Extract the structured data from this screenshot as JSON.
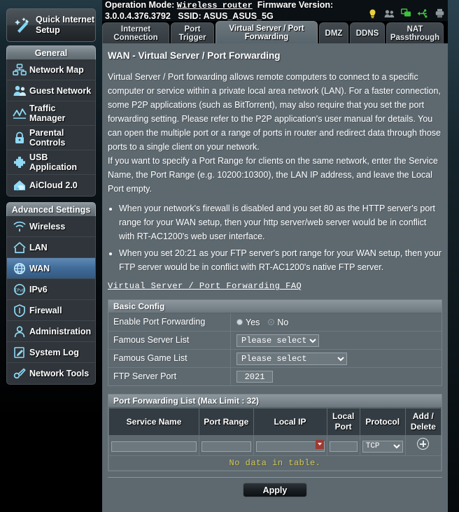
{
  "header": {
    "operation_mode_label": "Operation Mode:",
    "operation_mode_value": "Wireless router",
    "firmware_label": "Firmware Version:",
    "firmware_value": "3.0.0.4.376.3792",
    "ssid_label": "SSID:",
    "ssid_value": "ASUS_ASUS_5G",
    "icons": [
      {
        "name": "notification-icon",
        "glyph": "lamp",
        "color": "#e8d13c"
      },
      {
        "name": "clients-icon",
        "glyph": "people",
        "color": "#8f989d"
      },
      {
        "name": "monitors-icon",
        "glyph": "screens",
        "color": "#3ec13e"
      },
      {
        "name": "usb-icon",
        "glyph": "usb",
        "color": "#3ec13e"
      },
      {
        "name": "printer-icon",
        "glyph": "printer",
        "color": "#8f989d"
      }
    ]
  },
  "sidebar": {
    "quick_setup_label": "Quick Internet Setup",
    "general_header": "General",
    "general_items": [
      {
        "label": "Network Map",
        "icon": "network-map-icon"
      },
      {
        "label": "Guest Network",
        "icon": "guest-network-icon"
      },
      {
        "label": "Traffic Manager",
        "icon": "traffic-manager-icon"
      },
      {
        "label": "Parental Controls",
        "icon": "parental-controls-icon"
      },
      {
        "label": "USB Application",
        "icon": "usb-application-icon"
      },
      {
        "label": "AiCloud 2.0",
        "icon": "aicloud-icon"
      }
    ],
    "advanced_header": "Advanced Settings",
    "advanced_items": [
      {
        "label": "Wireless",
        "icon": "wireless-icon",
        "active": false
      },
      {
        "label": "LAN",
        "icon": "lan-icon",
        "active": false
      },
      {
        "label": "WAN",
        "icon": "wan-icon",
        "active": true
      },
      {
        "label": "IPv6",
        "icon": "ipv6-icon",
        "active": false
      },
      {
        "label": "Firewall",
        "icon": "firewall-icon",
        "active": false
      },
      {
        "label": "Administration",
        "icon": "administration-icon",
        "active": false
      },
      {
        "label": "System Log",
        "icon": "system-log-icon",
        "active": false
      },
      {
        "label": "Network Tools",
        "icon": "network-tools-icon",
        "active": false
      }
    ]
  },
  "tabs": [
    {
      "label": "Internet Connection",
      "active": false
    },
    {
      "label": "Port Trigger",
      "active": false
    },
    {
      "label": "Virtual Server / Port Forwarding",
      "active": true
    },
    {
      "label": "DMZ",
      "active": false
    },
    {
      "label": "DDNS",
      "active": false
    },
    {
      "label": "NAT Passthrough",
      "active": false
    }
  ],
  "main": {
    "page_title": "WAN - Virtual Server / Port Forwarding",
    "paragraphs": [
      "Virtual Server / Port forwarding allows remote computers to connect to a specific computer or service within a private local area network (LAN). For a faster connection, some P2P applications (such as BitTorrent), may also require that you set the port forwarding setting. Please refer to the P2P application's user manual for details. You can open the multiple port or a range of ports in router and redirect data through those ports to a single client on your network.",
      "If you want to specify a Port Range for clients on the same network, enter the Service Name, the Port Range (e.g. 10200:10300), the LAN IP address, and leave the Local Port empty."
    ],
    "bullets": [
      "When your network's firewall is disabled and you set 80 as the HTTP server's port range for your WAN setup, then your http server/web server would be in conflict with RT-AC1200's web user interface.",
      "When you set 20:21 as your FTP server's port range for your WAN setup, then your FTP server would be in conflict with RT-AC1200's native FTP server."
    ],
    "faq_link": "Virtual Server / Port Forwarding FAQ"
  },
  "basic_config": {
    "header": "Basic Config",
    "enable_label": "Enable Port Forwarding",
    "enable_yes": "Yes",
    "enable_no": "No",
    "enable_selected": "Yes",
    "famous_server_label": "Famous Server List",
    "famous_server_value": "Please select",
    "famous_game_label": "Famous Game List",
    "famous_game_value": "Please select",
    "ftp_port_label": "FTP Server Port",
    "ftp_port_value": "2021"
  },
  "forwarding_list": {
    "header": "Port Forwarding List (Max Limit : 32)",
    "columns": [
      "Service Name",
      "Port Range",
      "Local IP",
      "Local Port",
      "Protocol",
      "Add / Delete"
    ],
    "input_row": {
      "service_name": "",
      "port_range": "",
      "local_ip": "",
      "local_port": "",
      "protocol": "TCP"
    },
    "empty_message": "No data in table."
  },
  "footer": {
    "apply_label": "Apply"
  },
  "colors": {
    "panel_bg": "#5d686f",
    "accent_blue": "#3f6b98",
    "warning_yellow": "#d4c84a",
    "ip_arrow_red": "#9c3a33"
  }
}
